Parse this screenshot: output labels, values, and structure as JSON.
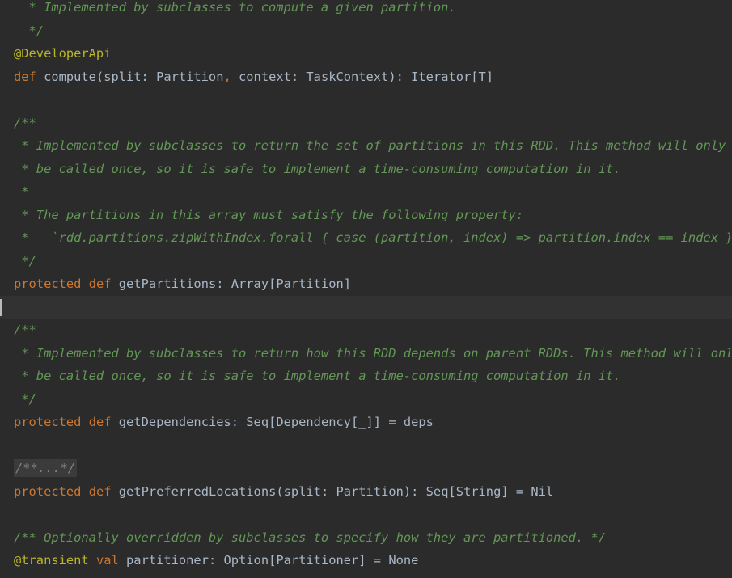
{
  "editor": {
    "lines": [
      [
        {
          "t": "  * Implemented by subclasses to compute a given partition.",
          "c": "cmt"
        }
      ],
      [
        {
          "t": "  */",
          "c": "cmt"
        }
      ],
      [
        {
          "t": "@DeveloperApi",
          "c": "ann"
        }
      ],
      [
        {
          "t": "def",
          "c": "kw"
        },
        {
          "t": " compute(split: Partition",
          "c": ""
        },
        {
          "t": ",",
          "c": "kw"
        },
        {
          "t": " context: TaskContext): Iterator[T]",
          "c": ""
        }
      ],
      [],
      [
        {
          "t": "/**",
          "c": "cmt"
        }
      ],
      [
        {
          "t": " * Implemented by subclasses to return the set of partitions in this RDD. This method will only",
          "c": "cmt"
        }
      ],
      [
        {
          "t": " * be called once, so it is safe to implement a time-consuming computation in it.",
          "c": "cmt"
        }
      ],
      [
        {
          "t": " *",
          "c": "cmt"
        }
      ],
      [
        {
          "t": " * The partitions in this array must satisfy the following property:",
          "c": "cmt"
        }
      ],
      [
        {
          "t": " *   `rdd.partitions.zipWithIndex.forall { case (partition, index) => partition.index == index }`",
          "c": "cmt"
        }
      ],
      [
        {
          "t": " */",
          "c": "cmt"
        }
      ],
      [
        {
          "t": "protected",
          "c": "kw"
        },
        {
          "t": " ",
          "c": ""
        },
        {
          "t": "def",
          "c": "kw"
        },
        {
          "t": " getPartitions: Array[Partition]",
          "c": ""
        }
      ],
      [],
      [
        {
          "t": "/**",
          "c": "cmt"
        }
      ],
      [
        {
          "t": " * Implemented by subclasses to return how this RDD depends on parent RDDs. This method will only",
          "c": "cmt"
        }
      ],
      [
        {
          "t": " * be called once, so it is safe to implement a time-consuming computation in it.",
          "c": "cmt"
        }
      ],
      [
        {
          "t": " */",
          "c": "cmt"
        }
      ],
      [
        {
          "t": "protected",
          "c": "kw"
        },
        {
          "t": " ",
          "c": ""
        },
        {
          "t": "def",
          "c": "kw"
        },
        {
          "t": " getDependencies: Seq[Dependency[_]] = deps",
          "c": ""
        }
      ],
      [],
      [
        {
          "t": "/**...*/",
          "c": "fold"
        }
      ],
      [
        {
          "t": "protected",
          "c": "kw"
        },
        {
          "t": " ",
          "c": ""
        },
        {
          "t": "def",
          "c": "kw"
        },
        {
          "t": " getPreferredLocations(split: Partition): Seq[String] = Nil",
          "c": ""
        }
      ],
      [],
      [
        {
          "t": "/** Optionally overridden by subclasses to specify how they are partitioned. */",
          "c": "cmt"
        }
      ],
      [
        {
          "t": "@transient",
          "c": "ann"
        },
        {
          "t": " ",
          "c": ""
        },
        {
          "t": "val",
          "c": "kw"
        },
        {
          "t": " partitioner: Option[Partitioner] = None",
          "c": ""
        }
      ]
    ],
    "current_line_index": 13,
    "colors": {
      "background": "#2b2b2b",
      "default_text": "#a9b7c6",
      "comment": "#629755",
      "keyword": "#cc7832",
      "annotation": "#bbb529",
      "current_line": "#323232",
      "fold_background": "#3b3b3b"
    }
  }
}
